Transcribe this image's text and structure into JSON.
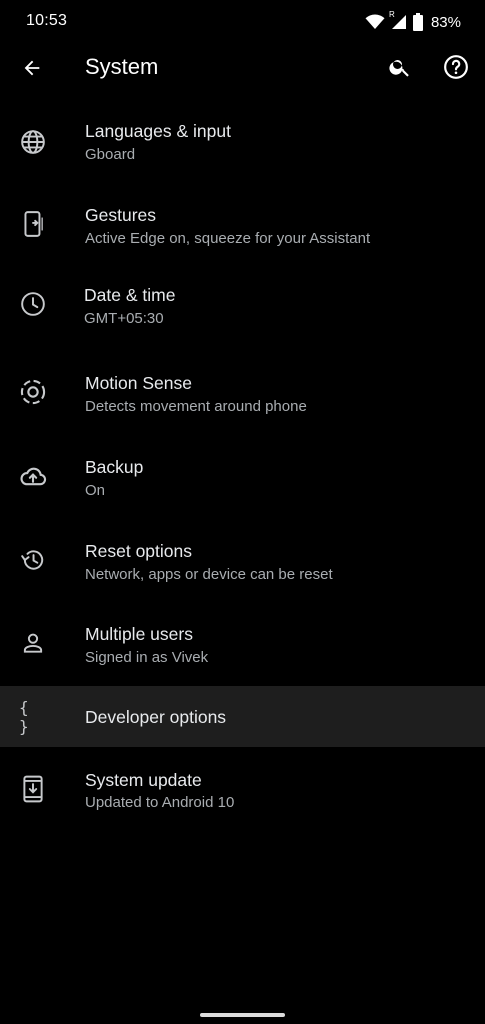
{
  "status_bar": {
    "time": "10:53",
    "network_badge": "R",
    "battery": "83%"
  },
  "app_bar": {
    "title": "System"
  },
  "items": [
    {
      "title": "Languages & input",
      "subtitle": "Gboard",
      "icon": "globe-icon"
    },
    {
      "title": "Gestures",
      "subtitle": "Active Edge on, squeeze for your Assistant",
      "icon": "gestures-phone-icon"
    },
    {
      "title": "Date & time",
      "subtitle": "GMT+05:30",
      "icon": "clock-icon"
    },
    {
      "title": "Motion Sense",
      "subtitle": "Detects movement around phone",
      "icon": "motion-sense-icon"
    },
    {
      "title": "Backup",
      "subtitle": "On",
      "icon": "cloud-upload-icon"
    },
    {
      "title": "Reset options",
      "subtitle": "Network, apps or device can be reset",
      "icon": "history-icon"
    },
    {
      "title": "Multiple users",
      "subtitle": "Signed in as Vivek",
      "icon": "person-icon"
    },
    {
      "title": "Developer options",
      "subtitle": "",
      "icon": "code-braces-icon",
      "icon_text": "{ }"
    },
    {
      "title": "System update",
      "subtitle": "Updated to Android 10",
      "icon": "system-update-icon"
    }
  ],
  "colors": {
    "background": "#000000",
    "highlight_row": "#1e1e1e",
    "title_text": "#e8eaed",
    "subtitle_text": "#a9adb1"
  }
}
